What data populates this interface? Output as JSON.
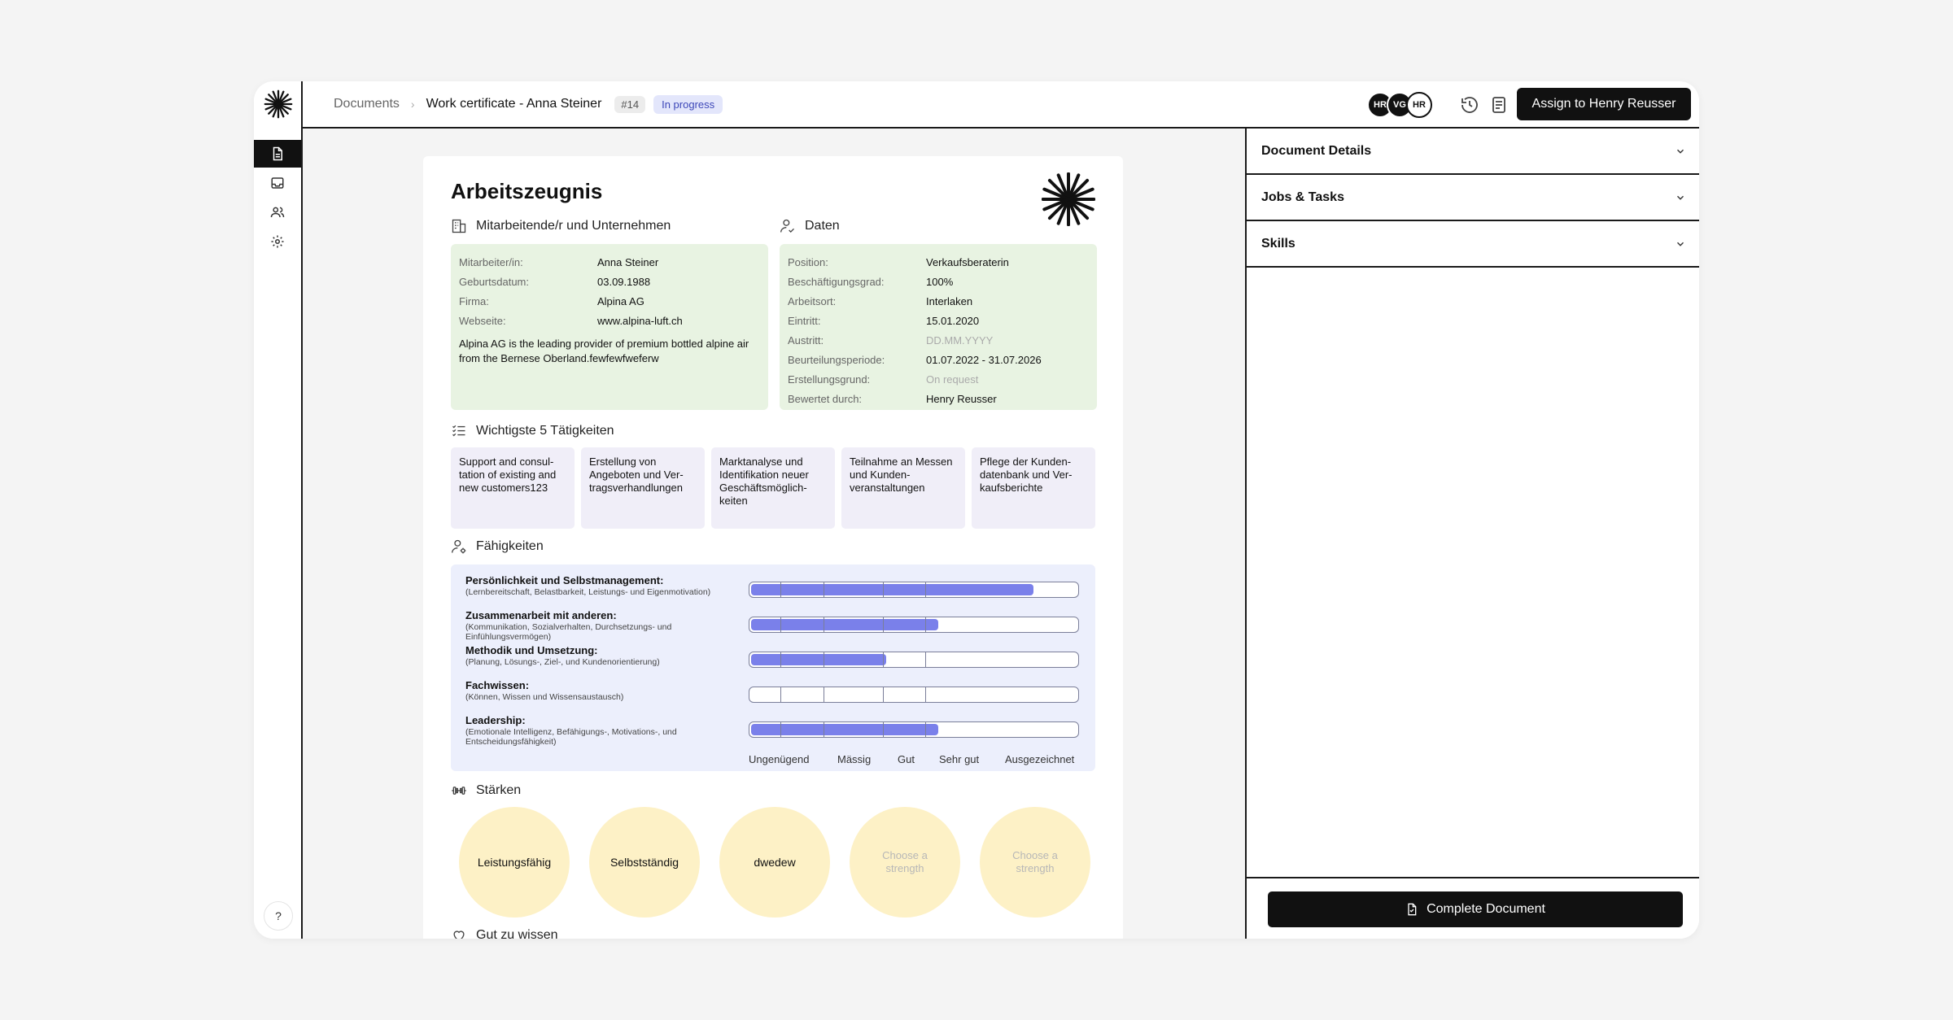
{
  "breadcrumb": {
    "root": "Documents",
    "title": "Work certificate - Anna Steiner",
    "id": "#14",
    "status": "In progress"
  },
  "avatars": [
    "HR",
    "VG",
    "HR"
  ],
  "header": {
    "assign_label": "Assign to Henry Reusser"
  },
  "doc": {
    "title": "Arbeitszeugnis",
    "employee_section": {
      "heading": "Mitarbeitende/r und Unternehmen",
      "fields": [
        {
          "label": "Mitarbeiter/in:",
          "value": "Anna Steiner"
        },
        {
          "label": "Geburtsdatum:",
          "value": "03.09.1988"
        },
        {
          "label": "Firma:",
          "value": "Alpina AG"
        },
        {
          "label": "Webseite:",
          "value": "www.alpina-luft.ch"
        }
      ],
      "description": "Alpina AG is the leading provider of premium bottled alpine air from the Bernese Oberland.fewfewfweferw"
    },
    "data_section": {
      "heading": "Daten",
      "fields": [
        {
          "label": "Position:",
          "value": "Verkaufsberaterin"
        },
        {
          "label": "Beschäftigungsgrad:",
          "value": "100%"
        },
        {
          "label": "Arbeitsort:",
          "value": "Interlaken"
        },
        {
          "label": "Eintritt:",
          "value": "15.01.2020"
        },
        {
          "label": "Austritt:",
          "value": "DD.MM.YYYY"
        },
        {
          "label": "Beurteilungsperiode:",
          "value": "01.07.2022 - 31.07.2026"
        },
        {
          "label": "Erstellungsgrund:",
          "value": "On request"
        },
        {
          "label": "Bewertet durch:",
          "value": "Henry Reusser"
        }
      ]
    },
    "tasks_section": {
      "heading": "Wichtigste 5 Tätigkeiten",
      "items": [
        "Support and consul-tation of existing and new customers123",
        "Erstellung von Angeboten und Ver-tragsverhandlungen",
        "Marktanalyse und Identifikation neuer Geschäftsmöglich-keiten",
        "Teilnahme an Messen und Kunden-veranstaltungen",
        "Pflege der Kunden-datenbank und Ver-kaufsberichte"
      ]
    },
    "skills_section": {
      "heading": "Fähigkeiten",
      "items": [
        {
          "title": "Persönlichkeit und Selbstmanagement:",
          "subtitle": "(Lernbereitschaft, Belastbarkeit, Leistungs- und Eigenmotivation)",
          "level": 0.87
        },
        {
          "title": "Zusammenarbeit mit anderen:",
          "subtitle": "(Kommunikation, Sozialverhalten, Durchsetzungs- und Einfühlungsvermögen)",
          "level": 0.58
        },
        {
          "title": "Methodik und Umsetzung:",
          "subtitle": "(Planung, Lösungs-, Ziel-, und Kundenorientierung)",
          "level": 0.42
        },
        {
          "title": "Fachwissen:",
          "subtitle": "(Können, Wissen und Wissensaustausch)",
          "level": 0
        },
        {
          "title": "Leadership:",
          "subtitle": "(Emotionale Intelligenz, Befähigungs-, Motivations-, und Entscheidungsfähigkeit)",
          "level": 0.58
        }
      ],
      "scale": [
        "Ungenügend",
        "Mässig",
        "Gut",
        "Sehr gut",
        "Ausgezeichnet"
      ]
    },
    "strengths_section": {
      "heading": "Stärken",
      "items": [
        {
          "label": "Leistungsfähig",
          "placeholder": false
        },
        {
          "label": "Selbstständig",
          "placeholder": false
        },
        {
          "label": "dwedew",
          "placeholder": false
        },
        {
          "label": "Choose a strength",
          "placeholder": true
        },
        {
          "label": "Choose a strength",
          "placeholder": true
        }
      ]
    },
    "next_section": {
      "heading": "Gut zu wissen"
    }
  },
  "panel": {
    "sections": [
      "Document Details",
      "Jobs & Tasks",
      "Skills"
    ],
    "complete_label": "Complete Document"
  },
  "help_label": "?",
  "colors": {
    "green_card": "#e8f3e2",
    "task_card": "#f0eef8",
    "skills_card": "#eceffc",
    "bar_fill": "#7a80ea",
    "strength_bubble": "#fdf1c6",
    "status_pill": "#e3e6fb"
  }
}
